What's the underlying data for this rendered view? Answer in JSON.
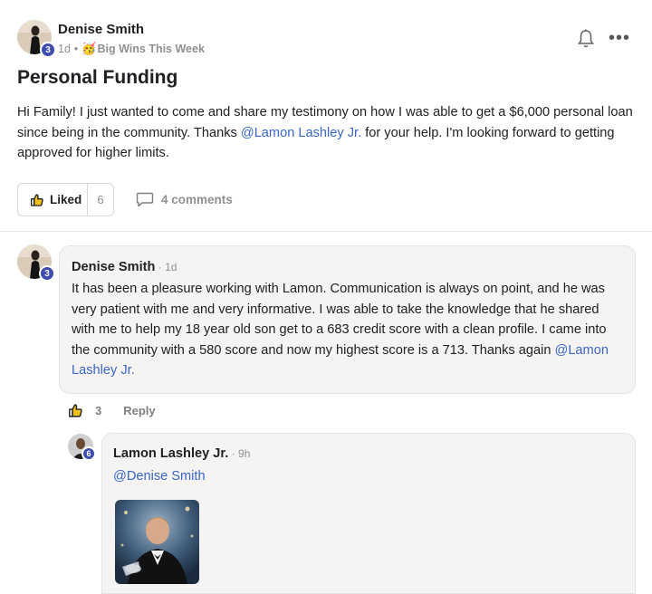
{
  "post": {
    "author": "Denise Smith",
    "author_level": "3",
    "time": "1d",
    "separator": "•",
    "category_emoji": "🥳",
    "category": "Big Wins This Week",
    "title": "Personal Funding",
    "body_before": "Hi Family! I just wanted to come and share my testimony on how I was able to get a $6,000 personal loan since being in the community. Thanks ",
    "body_mention": "@Lamon Lashley Jr.",
    "body_after": " for your help. I'm looking forward to getting approved for higher limits.",
    "like_label": "Liked",
    "like_count": "6",
    "comments_label": "4 comments"
  },
  "icons": {
    "bell": "bell-icon",
    "more": "more-dots-icon",
    "like": "thumbs-up-icon",
    "comment": "comment-bubble-icon"
  },
  "comment": {
    "author": "Denise Smith",
    "author_level": "3",
    "time_sep": " · ",
    "time": "1d",
    "body": "It has been a pleasure working with Lamon. Communication is always on point, and he was very patient with me and very informative. I was able to take the knowledge that he shared with me to help my 18 year old son get to a 683 credit score with a clean profile. I came into the community with a 580 score and now my highest score is a 713. Thanks again ",
    "mention": "@Lamon Lashley Jr.",
    "like_count": "3",
    "reply_label": "Reply"
  },
  "reply": {
    "author": "Lamon Lashley Jr.",
    "author_level": "6",
    "time_sep": " · ",
    "time": "9h",
    "mention": "@Denise Smith"
  },
  "colors": {
    "accent_link": "#3a66c4",
    "level_badge": "#3f4cb0",
    "bubble_bg": "#f5f4f2"
  }
}
